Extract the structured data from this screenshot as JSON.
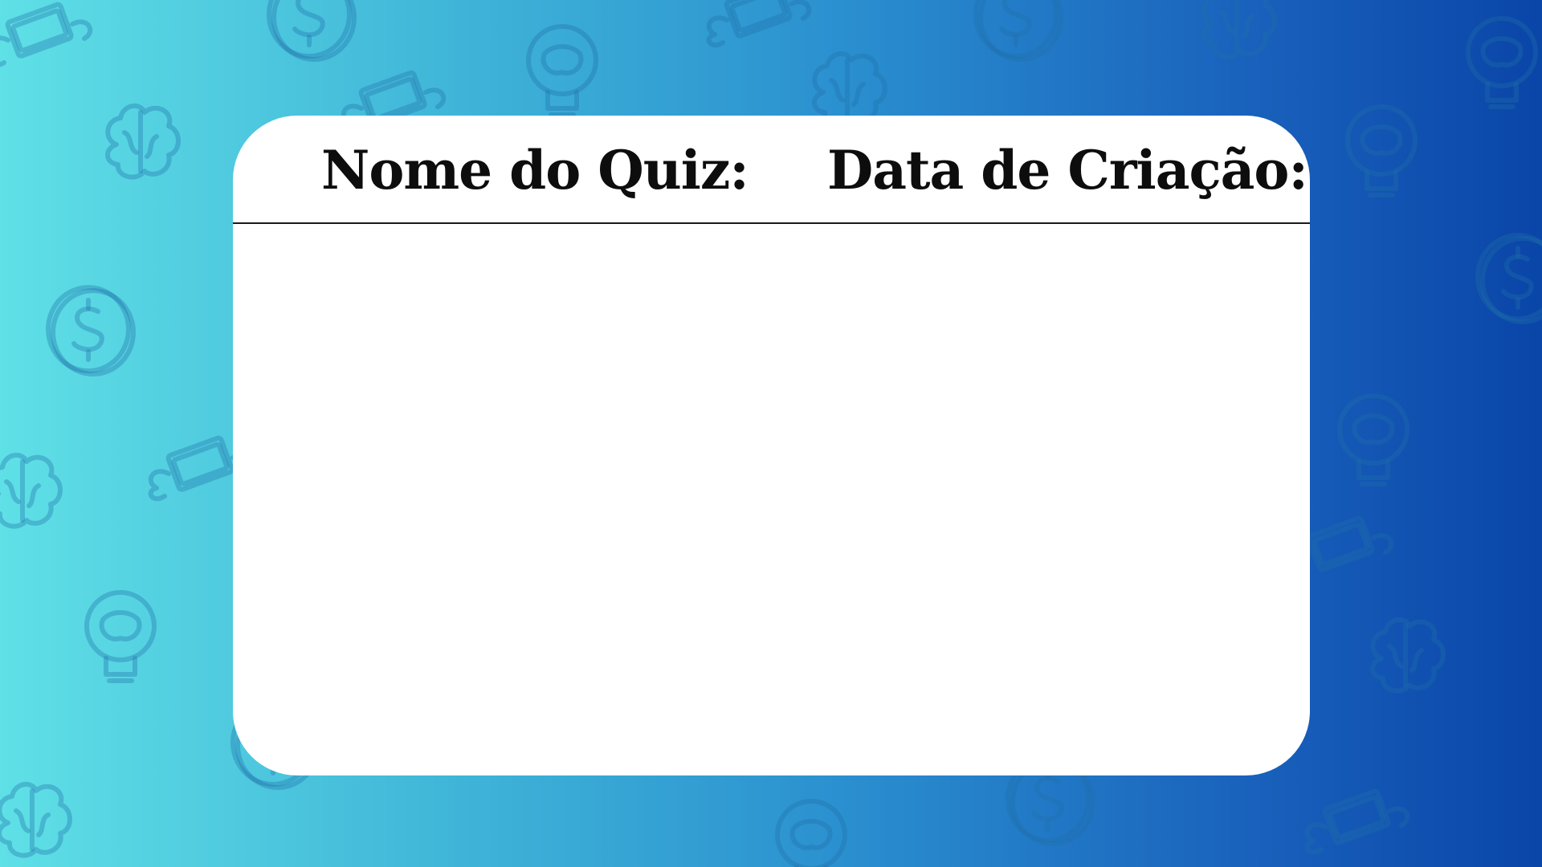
{
  "card": {
    "quiz_name_label": "Nome do Quiz:",
    "creation_date_label": "Data de Criação:",
    "quiz_name_value": "",
    "creation_date_value": ""
  },
  "theme": {
    "background_gradient_start": "#5fe0e6",
    "background_gradient_end": "#0a45a8",
    "card_color": "#ffffff",
    "text_color": "#0d0d0d",
    "pattern_icons": [
      "brain-icon",
      "lightbulb-brain-icon",
      "coin-dollar-icon",
      "flying-money-icon"
    ]
  }
}
